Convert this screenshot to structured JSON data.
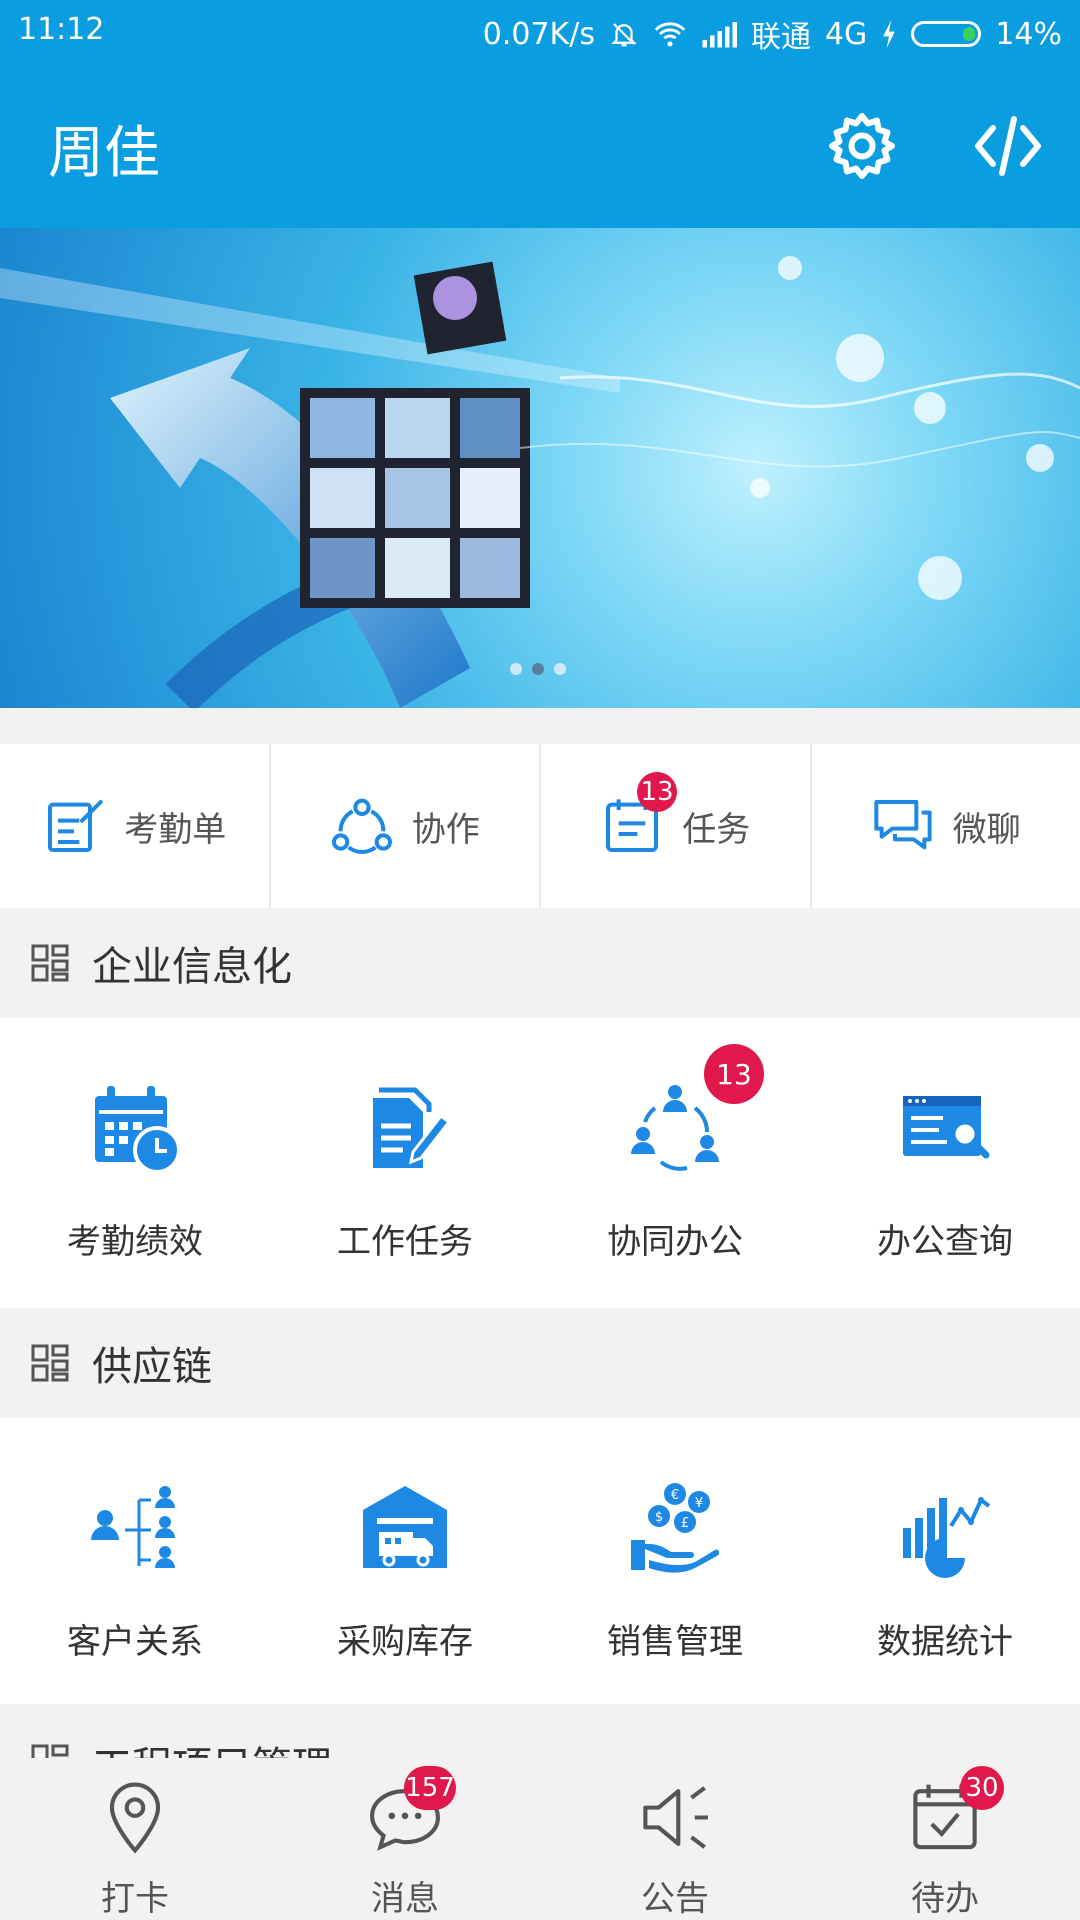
{
  "status_bar": {
    "time": "11:12",
    "speed": "0.07K/s",
    "carrier": "联通",
    "network": "4G",
    "battery": "14%"
  },
  "header": {
    "title": "周佳",
    "settings_icon": "gear-icon",
    "code_icon": "code-icon"
  },
  "banner": {
    "active_dot_index": 1,
    "dot_count": 3
  },
  "quick_actions": [
    {
      "label": "考勤单",
      "icon": "form-edit-icon",
      "badge": ""
    },
    {
      "label": "协作",
      "icon": "collaboration-icon",
      "badge": ""
    },
    {
      "label": "任务",
      "icon": "task-list-icon",
      "badge": "13"
    },
    {
      "label": "微聊",
      "icon": "chat-icon",
      "badge": ""
    }
  ],
  "sections": [
    {
      "title": "企业信息化",
      "items": [
        {
          "label": "考勤绩效",
          "icon": "calendar-clock-icon",
          "badge": ""
        },
        {
          "label": "工作任务",
          "icon": "document-pen-icon",
          "badge": ""
        },
        {
          "label": "协同办公",
          "icon": "team-cycle-icon",
          "badge": "13"
        },
        {
          "label": "办公查询",
          "icon": "search-window-icon",
          "badge": ""
        }
      ]
    },
    {
      "title": "供应链",
      "items": [
        {
          "label": "客户关系",
          "icon": "org-chart-icon",
          "badge": ""
        },
        {
          "label": "采购库存",
          "icon": "warehouse-truck-icon",
          "badge": ""
        },
        {
          "label": "销售管理",
          "icon": "hand-money-icon",
          "badge": ""
        },
        {
          "label": "数据统计",
          "icon": "chart-stats-icon",
          "badge": ""
        }
      ]
    },
    {
      "title": "工程项目管理"
    }
  ],
  "tabs": [
    {
      "label": "打卡",
      "icon": "location-pin-icon",
      "badge": ""
    },
    {
      "label": "消息",
      "icon": "message-bubble-icon",
      "badge": "157"
    },
    {
      "label": "公告",
      "icon": "speaker-icon",
      "badge": ""
    },
    {
      "label": "待办",
      "icon": "calendar-check-icon",
      "badge": "30"
    }
  ],
  "colors": {
    "brand": "#0a9ee0",
    "icon_blue": "#1e88e5",
    "badge_red": "#e0184c"
  }
}
